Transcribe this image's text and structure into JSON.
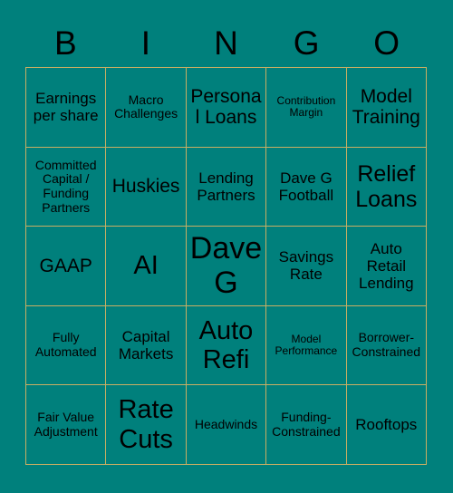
{
  "card": {
    "background_color": "#00807C",
    "grid_line_color": "#C9AE63",
    "text_color": "#000000"
  },
  "header": {
    "letters": [
      {
        "label": "B"
      },
      {
        "label": "I"
      },
      {
        "label": "N"
      },
      {
        "label": "G"
      },
      {
        "label": "O"
      }
    ]
  },
  "grid": {
    "rows": 5,
    "columns": 5,
    "cells": [
      {
        "label": "Earnings per share",
        "size": "md",
        "column": "B",
        "row": 1
      },
      {
        "label": "Macro Challenges",
        "size": "sm",
        "column": "I",
        "row": 1
      },
      {
        "label": "Personal Loans",
        "size": "lg",
        "column": "N",
        "row": 1
      },
      {
        "label": "Contribution Margin",
        "size": "xs",
        "column": "G",
        "row": 1
      },
      {
        "label": "Model Training",
        "size": "lg",
        "column": "O",
        "row": 1
      },
      {
        "label": "Committed Capital / Funding Partners",
        "size": "sm",
        "column": "B",
        "row": 2
      },
      {
        "label": "Huskies",
        "size": "lg",
        "column": "I",
        "row": 2
      },
      {
        "label": "Lending Partners",
        "size": "md",
        "column": "N",
        "row": 2
      },
      {
        "label": "Dave G Football",
        "size": "md",
        "column": "G",
        "row": 2
      },
      {
        "label": "Relief Loans",
        "size": "xl",
        "column": "O",
        "row": 2
      },
      {
        "label": "GAAP",
        "size": "lg",
        "column": "B",
        "row": 3
      },
      {
        "label": "AI",
        "size": "xxl",
        "column": "I",
        "row": 3
      },
      {
        "label": "Dave G",
        "size": "huge",
        "column": "N",
        "row": 3
      },
      {
        "label": "Savings Rate",
        "size": "md",
        "column": "G",
        "row": 3
      },
      {
        "label": "Auto Retail Lending",
        "size": "md",
        "column": "O",
        "row": 3
      },
      {
        "label": "Fully Automated",
        "size": "sm",
        "column": "B",
        "row": 4
      },
      {
        "label": "Capital Markets",
        "size": "md",
        "column": "I",
        "row": 4
      },
      {
        "label": "Auto Refi",
        "size": "xxl",
        "column": "N",
        "row": 4
      },
      {
        "label": "Model Performance",
        "size": "xs",
        "column": "G",
        "row": 4
      },
      {
        "label": "Borrower-Constrained",
        "size": "sm",
        "column": "O",
        "row": 4
      },
      {
        "label": "Fair Value Adjustment",
        "size": "sm",
        "column": "B",
        "row": 5
      },
      {
        "label": "Rate Cuts",
        "size": "xxl",
        "column": "I",
        "row": 5
      },
      {
        "label": "Headwinds",
        "size": "sm",
        "column": "N",
        "row": 5
      },
      {
        "label": "Funding-Constrained",
        "size": "sm",
        "column": "G",
        "row": 5
      },
      {
        "label": "Rooftops",
        "size": "md",
        "column": "O",
        "row": 5
      }
    ]
  }
}
